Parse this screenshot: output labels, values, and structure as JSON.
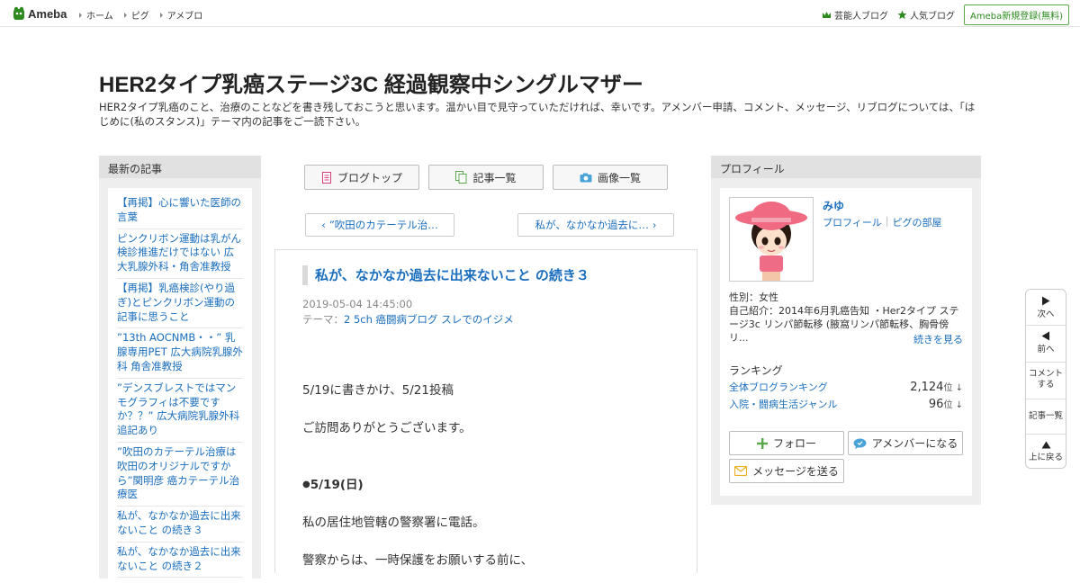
{
  "topbar": {
    "logo_text": "Ameba",
    "nav": [
      "ホーム",
      "ピグ",
      "アメブロ"
    ],
    "right_links": [
      "芸能人ブログ",
      "人気ブログ"
    ],
    "register_label": "Ameba新規登録(無料)"
  },
  "blog": {
    "title": "HER2タイプ乳癌ステージ3C 経過観察中シングルマザー",
    "description": "HER2タイプ乳癌のこと、治療のことなどを書き残しておこうと思います。温かい目で見守っていただければ、幸いです。アメンバー申請、コメント、メッセージ、リブログについては、「はじめに(私のスタンス)」テーマ内の記事をご一読下さい。"
  },
  "left_sidebar": {
    "heading": "最新の記事",
    "entries": [
      "【再掲】心に響いた医師の言葉",
      "ピンクリボン運動は乳がん検診推進だけではない 広大乳腺外科・角舎准教授",
      "【再掲】乳癌検診(やり過ぎ)とピンクリボン運動の記事に思うこと",
      "”13th AOCNMB・・” 乳腺専用PET 広大病院乳腺外科 角舎准教授",
      "”デンスブレストではマンモグラフィは不要ですか？？” 広大病院乳腺外科追記あり",
      "”吹田のカテーテル治療は吹田のオリジナルですから”関明彦 癌カテーテル治療医",
      "私が、なかなか過去に出来ないこと の続き３",
      "私が、なかなか過去に出来ないこと の続き２"
    ]
  },
  "center": {
    "tabs": [
      "ブログトップ",
      "記事一覧",
      "画像一覧"
    ],
    "prev_label": "”吹田のカテーテル治…",
    "next_label": "私が、なかなか過去に…",
    "article": {
      "title": "私が、なかなか過去に出来ないこと の続き３",
      "date": "2019-05-04 14:45:00",
      "theme_label": "テーマ：",
      "theme": "2 5ch 癌闘病ブログ スレでのイジメ",
      "paragraphs": [
        "5/19に書きかけ、5/21投稿",
        "ご訪問ありがとうございます。",
        "5/19(日)",
        "私の居住地管轄の警察署に電話。",
        "警察からは、一時保護をお願いする前に、"
      ]
    }
  },
  "right_sidebar": {
    "heading": "プロフィール",
    "name": "みゆ",
    "links": [
      "プロフィール",
      "ピグの部屋"
    ],
    "gender": "性別：女性",
    "intro": "自己紹介：2014年6月乳癌告知 ・Her2タイプ ステージ3c リンパ節転移 (腋窩リンパ節転移、胸骨傍リ...",
    "more": "続きを見る",
    "ranking_heading": "ランキング",
    "rankings": [
      {
        "label": "全体ブログランキング",
        "value": "2,124",
        "unit": "位 ↓"
      },
      {
        "label": "入院・闘病生活ジャンル",
        "value": "96",
        "unit": "位 ↓"
      }
    ],
    "buttons": [
      "フォロー",
      "アメンバーになる",
      "メッセージを送る"
    ]
  },
  "floatnav": {
    "next": "次へ",
    "prev": "前へ",
    "comment_1": "コメント",
    "comment_2": "する",
    "list": "記事一覧",
    "top": "上に戻る"
  },
  "colors": {
    "link": "#1a6ebd",
    "green": "#2d8a1e",
    "sidebar_bg": "#eeeeee"
  }
}
